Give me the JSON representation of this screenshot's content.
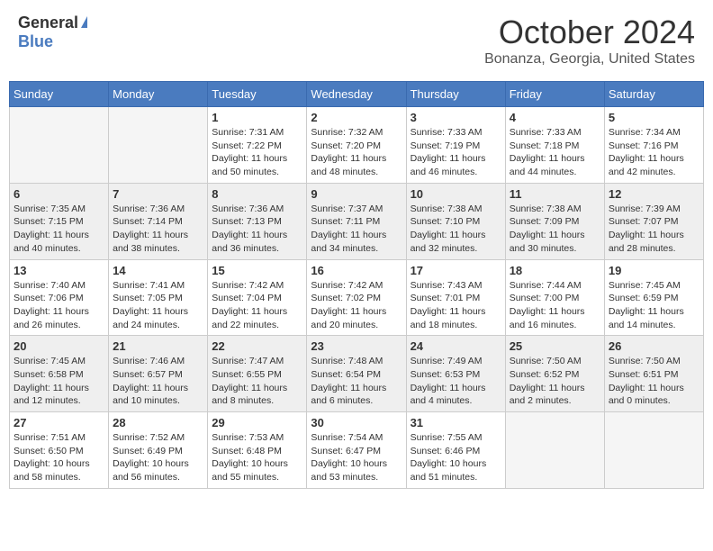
{
  "header": {
    "logo_general": "General",
    "logo_blue": "Blue",
    "month_title": "October 2024",
    "location": "Bonanza, Georgia, United States"
  },
  "days_of_week": [
    "Sunday",
    "Monday",
    "Tuesday",
    "Wednesday",
    "Thursday",
    "Friday",
    "Saturday"
  ],
  "weeks": [
    [
      {
        "day": "",
        "empty": true
      },
      {
        "day": "",
        "empty": true
      },
      {
        "day": "1",
        "sunrise": "Sunrise: 7:31 AM",
        "sunset": "Sunset: 7:22 PM",
        "daylight": "Daylight: 11 hours and 50 minutes."
      },
      {
        "day": "2",
        "sunrise": "Sunrise: 7:32 AM",
        "sunset": "Sunset: 7:20 PM",
        "daylight": "Daylight: 11 hours and 48 minutes."
      },
      {
        "day": "3",
        "sunrise": "Sunrise: 7:33 AM",
        "sunset": "Sunset: 7:19 PM",
        "daylight": "Daylight: 11 hours and 46 minutes."
      },
      {
        "day": "4",
        "sunrise": "Sunrise: 7:33 AM",
        "sunset": "Sunset: 7:18 PM",
        "daylight": "Daylight: 11 hours and 44 minutes."
      },
      {
        "day": "5",
        "sunrise": "Sunrise: 7:34 AM",
        "sunset": "Sunset: 7:16 PM",
        "daylight": "Daylight: 11 hours and 42 minutes."
      }
    ],
    [
      {
        "day": "6",
        "sunrise": "Sunrise: 7:35 AM",
        "sunset": "Sunset: 7:15 PM",
        "daylight": "Daylight: 11 hours and 40 minutes."
      },
      {
        "day": "7",
        "sunrise": "Sunrise: 7:36 AM",
        "sunset": "Sunset: 7:14 PM",
        "daylight": "Daylight: 11 hours and 38 minutes."
      },
      {
        "day": "8",
        "sunrise": "Sunrise: 7:36 AM",
        "sunset": "Sunset: 7:13 PM",
        "daylight": "Daylight: 11 hours and 36 minutes."
      },
      {
        "day": "9",
        "sunrise": "Sunrise: 7:37 AM",
        "sunset": "Sunset: 7:11 PM",
        "daylight": "Daylight: 11 hours and 34 minutes."
      },
      {
        "day": "10",
        "sunrise": "Sunrise: 7:38 AM",
        "sunset": "Sunset: 7:10 PM",
        "daylight": "Daylight: 11 hours and 32 minutes."
      },
      {
        "day": "11",
        "sunrise": "Sunrise: 7:38 AM",
        "sunset": "Sunset: 7:09 PM",
        "daylight": "Daylight: 11 hours and 30 minutes."
      },
      {
        "day": "12",
        "sunrise": "Sunrise: 7:39 AM",
        "sunset": "Sunset: 7:07 PM",
        "daylight": "Daylight: 11 hours and 28 minutes."
      }
    ],
    [
      {
        "day": "13",
        "sunrise": "Sunrise: 7:40 AM",
        "sunset": "Sunset: 7:06 PM",
        "daylight": "Daylight: 11 hours and 26 minutes."
      },
      {
        "day": "14",
        "sunrise": "Sunrise: 7:41 AM",
        "sunset": "Sunset: 7:05 PM",
        "daylight": "Daylight: 11 hours and 24 minutes."
      },
      {
        "day": "15",
        "sunrise": "Sunrise: 7:42 AM",
        "sunset": "Sunset: 7:04 PM",
        "daylight": "Daylight: 11 hours and 22 minutes."
      },
      {
        "day": "16",
        "sunrise": "Sunrise: 7:42 AM",
        "sunset": "Sunset: 7:02 PM",
        "daylight": "Daylight: 11 hours and 20 minutes."
      },
      {
        "day": "17",
        "sunrise": "Sunrise: 7:43 AM",
        "sunset": "Sunset: 7:01 PM",
        "daylight": "Daylight: 11 hours and 18 minutes."
      },
      {
        "day": "18",
        "sunrise": "Sunrise: 7:44 AM",
        "sunset": "Sunset: 7:00 PM",
        "daylight": "Daylight: 11 hours and 16 minutes."
      },
      {
        "day": "19",
        "sunrise": "Sunrise: 7:45 AM",
        "sunset": "Sunset: 6:59 PM",
        "daylight": "Daylight: 11 hours and 14 minutes."
      }
    ],
    [
      {
        "day": "20",
        "sunrise": "Sunrise: 7:45 AM",
        "sunset": "Sunset: 6:58 PM",
        "daylight": "Daylight: 11 hours and 12 minutes."
      },
      {
        "day": "21",
        "sunrise": "Sunrise: 7:46 AM",
        "sunset": "Sunset: 6:57 PM",
        "daylight": "Daylight: 11 hours and 10 minutes."
      },
      {
        "day": "22",
        "sunrise": "Sunrise: 7:47 AM",
        "sunset": "Sunset: 6:55 PM",
        "daylight": "Daylight: 11 hours and 8 minutes."
      },
      {
        "day": "23",
        "sunrise": "Sunrise: 7:48 AM",
        "sunset": "Sunset: 6:54 PM",
        "daylight": "Daylight: 11 hours and 6 minutes."
      },
      {
        "day": "24",
        "sunrise": "Sunrise: 7:49 AM",
        "sunset": "Sunset: 6:53 PM",
        "daylight": "Daylight: 11 hours and 4 minutes."
      },
      {
        "day": "25",
        "sunrise": "Sunrise: 7:50 AM",
        "sunset": "Sunset: 6:52 PM",
        "daylight": "Daylight: 11 hours and 2 minutes."
      },
      {
        "day": "26",
        "sunrise": "Sunrise: 7:50 AM",
        "sunset": "Sunset: 6:51 PM",
        "daylight": "Daylight: 11 hours and 0 minutes."
      }
    ],
    [
      {
        "day": "27",
        "sunrise": "Sunrise: 7:51 AM",
        "sunset": "Sunset: 6:50 PM",
        "daylight": "Daylight: 10 hours and 58 minutes."
      },
      {
        "day": "28",
        "sunrise": "Sunrise: 7:52 AM",
        "sunset": "Sunset: 6:49 PM",
        "daylight": "Daylight: 10 hours and 56 minutes."
      },
      {
        "day": "29",
        "sunrise": "Sunrise: 7:53 AM",
        "sunset": "Sunset: 6:48 PM",
        "daylight": "Daylight: 10 hours and 55 minutes."
      },
      {
        "day": "30",
        "sunrise": "Sunrise: 7:54 AM",
        "sunset": "Sunset: 6:47 PM",
        "daylight": "Daylight: 10 hours and 53 minutes."
      },
      {
        "day": "31",
        "sunrise": "Sunrise: 7:55 AM",
        "sunset": "Sunset: 6:46 PM",
        "daylight": "Daylight: 10 hours and 51 minutes."
      },
      {
        "day": "",
        "empty": true
      },
      {
        "day": "",
        "empty": true
      }
    ]
  ]
}
